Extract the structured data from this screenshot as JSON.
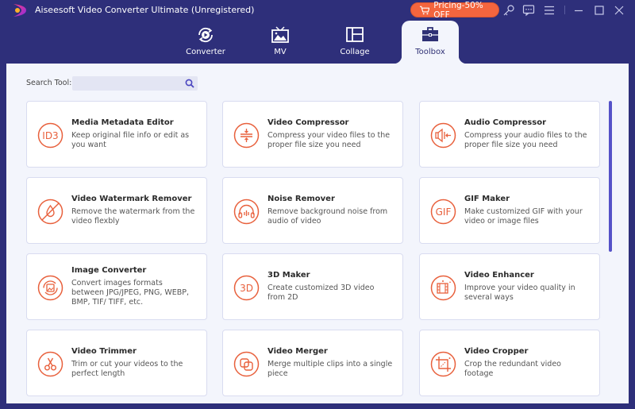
{
  "window": {
    "title": "Aiseesoft Video Converter Ultimate (Unregistered)",
    "logo": "aiseesoft-logo-icon",
    "pricing_button": "Pricing-50% OFF",
    "controls": [
      "key-icon",
      "feedback-icon",
      "menu-icon",
      "minimize-icon",
      "maximize-icon",
      "close-icon"
    ]
  },
  "nav": {
    "tabs": [
      {
        "label": "Converter",
        "icon": "converter-icon",
        "active": false
      },
      {
        "label": "MV",
        "icon": "mv-icon",
        "active": false
      },
      {
        "label": "Collage",
        "icon": "collage-icon",
        "active": false
      },
      {
        "label": "Toolbox",
        "icon": "toolbox-icon",
        "active": true
      }
    ]
  },
  "search": {
    "label": "Search Tool:",
    "value": "",
    "placeholder": ""
  },
  "tools": [
    {
      "title": "Media Metadata Editor",
      "desc": "Keep original file info or edit as you want",
      "icon": "id3-icon"
    },
    {
      "title": "Video Compressor",
      "desc": "Compress your video files to the proper file size you need",
      "icon": "compress-icon"
    },
    {
      "title": "Audio Compressor",
      "desc": "Compress your audio files to the proper file size you need",
      "icon": "audio-compress-icon"
    },
    {
      "title": "Video Watermark Remover",
      "desc": "Remove the watermark from the video flexbly",
      "icon": "watermark-remove-icon"
    },
    {
      "title": "Noise Remover",
      "desc": "Remove background noise from audio of video",
      "icon": "headphones-icon"
    },
    {
      "title": "GIF Maker",
      "desc": "Make customized GIF with your video or image files",
      "icon": "gif-icon"
    },
    {
      "title": "Image Converter",
      "desc": "Convert images formats between JPG/JPEG, PNG, WEBP, BMP, TIF/ TIFF, etc.",
      "icon": "image-convert-icon"
    },
    {
      "title": "3D Maker",
      "desc": "Create customized 3D video from 2D",
      "icon": "3d-icon"
    },
    {
      "title": "Video Enhancer",
      "desc": "Improve your video quality in several ways",
      "icon": "enhance-icon"
    },
    {
      "title": "Video Trimmer",
      "desc": "Trim or cut your videos to the perfect length",
      "icon": "scissors-icon"
    },
    {
      "title": "Video Merger",
      "desc": "Merge multiple clips into a single piece",
      "icon": "merge-icon"
    },
    {
      "title": "Video Cropper",
      "desc": "Crop the redundant video footage",
      "icon": "crop-icon"
    }
  ],
  "colors": {
    "background": "#2e2f7a",
    "panel": "#f3f5fc",
    "accent": "#f4653e",
    "icon_stroke": "#e8603c",
    "scrollbar": "#5552c8"
  }
}
